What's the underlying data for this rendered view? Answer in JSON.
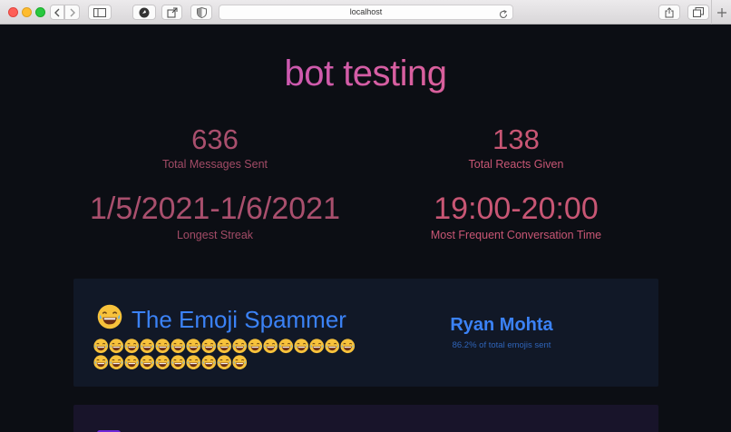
{
  "browser": {
    "address": "localhost",
    "buttons": [
      "back",
      "forward",
      "sidebar",
      "history",
      "share",
      "tabs",
      "new-tab"
    ]
  },
  "page": {
    "title": "bot testing",
    "stats": [
      {
        "value": "636",
        "label": "Total Messages Sent"
      },
      {
        "value": "138",
        "label": "Total Reacts Given"
      },
      {
        "value": "1/5/2021-1/6/2021",
        "label": "Longest Streak"
      },
      {
        "value": "19:00-20:00",
        "label": "Most Frequent Conversation Time"
      }
    ],
    "emoji_card": {
      "title": "The Emoji Spammer",
      "emoji": "😂",
      "emoji_count_displayed": 27,
      "winner_name": "Ryan Mohta",
      "winner_detail": "86.2% of total emojis sent"
    }
  },
  "colors": {
    "title_gradient": [
      "#b04ad6",
      "#e05d7e"
    ],
    "stat_color": "#a94f6d",
    "accent_blue": "#3b82f6",
    "card_bg": "#111827",
    "page_bg": "#0c0e14"
  }
}
